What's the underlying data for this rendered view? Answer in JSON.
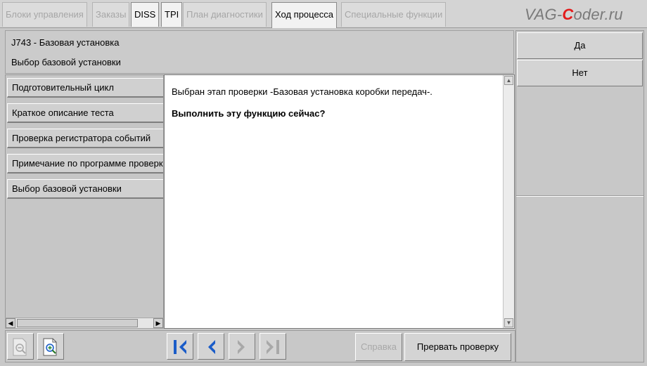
{
  "tabs": [
    {
      "label": "Блоки управления",
      "state": "disabled"
    },
    {
      "label": "Заказы",
      "state": "disabled"
    },
    {
      "label": "DISS",
      "state": "enabled"
    },
    {
      "label": "TPI",
      "state": "enabled"
    },
    {
      "label": "План диагностики",
      "state": "disabled"
    },
    {
      "label": "Ход процесса",
      "state": "active"
    },
    {
      "label": "Специальные функции",
      "state": "disabled"
    }
  ],
  "logo": {
    "prefix": "VAG-",
    "accent": "C",
    "suffix": "oder.ru"
  },
  "header": {
    "line1": "J743 - Базовая установка",
    "line2": "Выбор базовой установки"
  },
  "nav": {
    "items": [
      {
        "label": "Подготовительный цикл"
      },
      {
        "label": "Краткое описание теста"
      },
      {
        "label": "Проверка регистратора событий"
      },
      {
        "label": "Примечание по программе проверки"
      },
      {
        "label": "Выбор базовой установки"
      }
    ]
  },
  "content": {
    "message": "Выбран этап проверки -Базовая установка коробки передач-.",
    "question": "Выполнить эту функцию сейчас?"
  },
  "right": {
    "yes_label": "Да",
    "no_label": "Нет"
  },
  "toolbar": {
    "help_label": "Справка",
    "abort_label": "Прервать проверку"
  },
  "colors": {
    "nav_blue": "#1a5cc8",
    "nav_disabled": "#a8a8a8",
    "logo_accent": "#e31b1b"
  }
}
